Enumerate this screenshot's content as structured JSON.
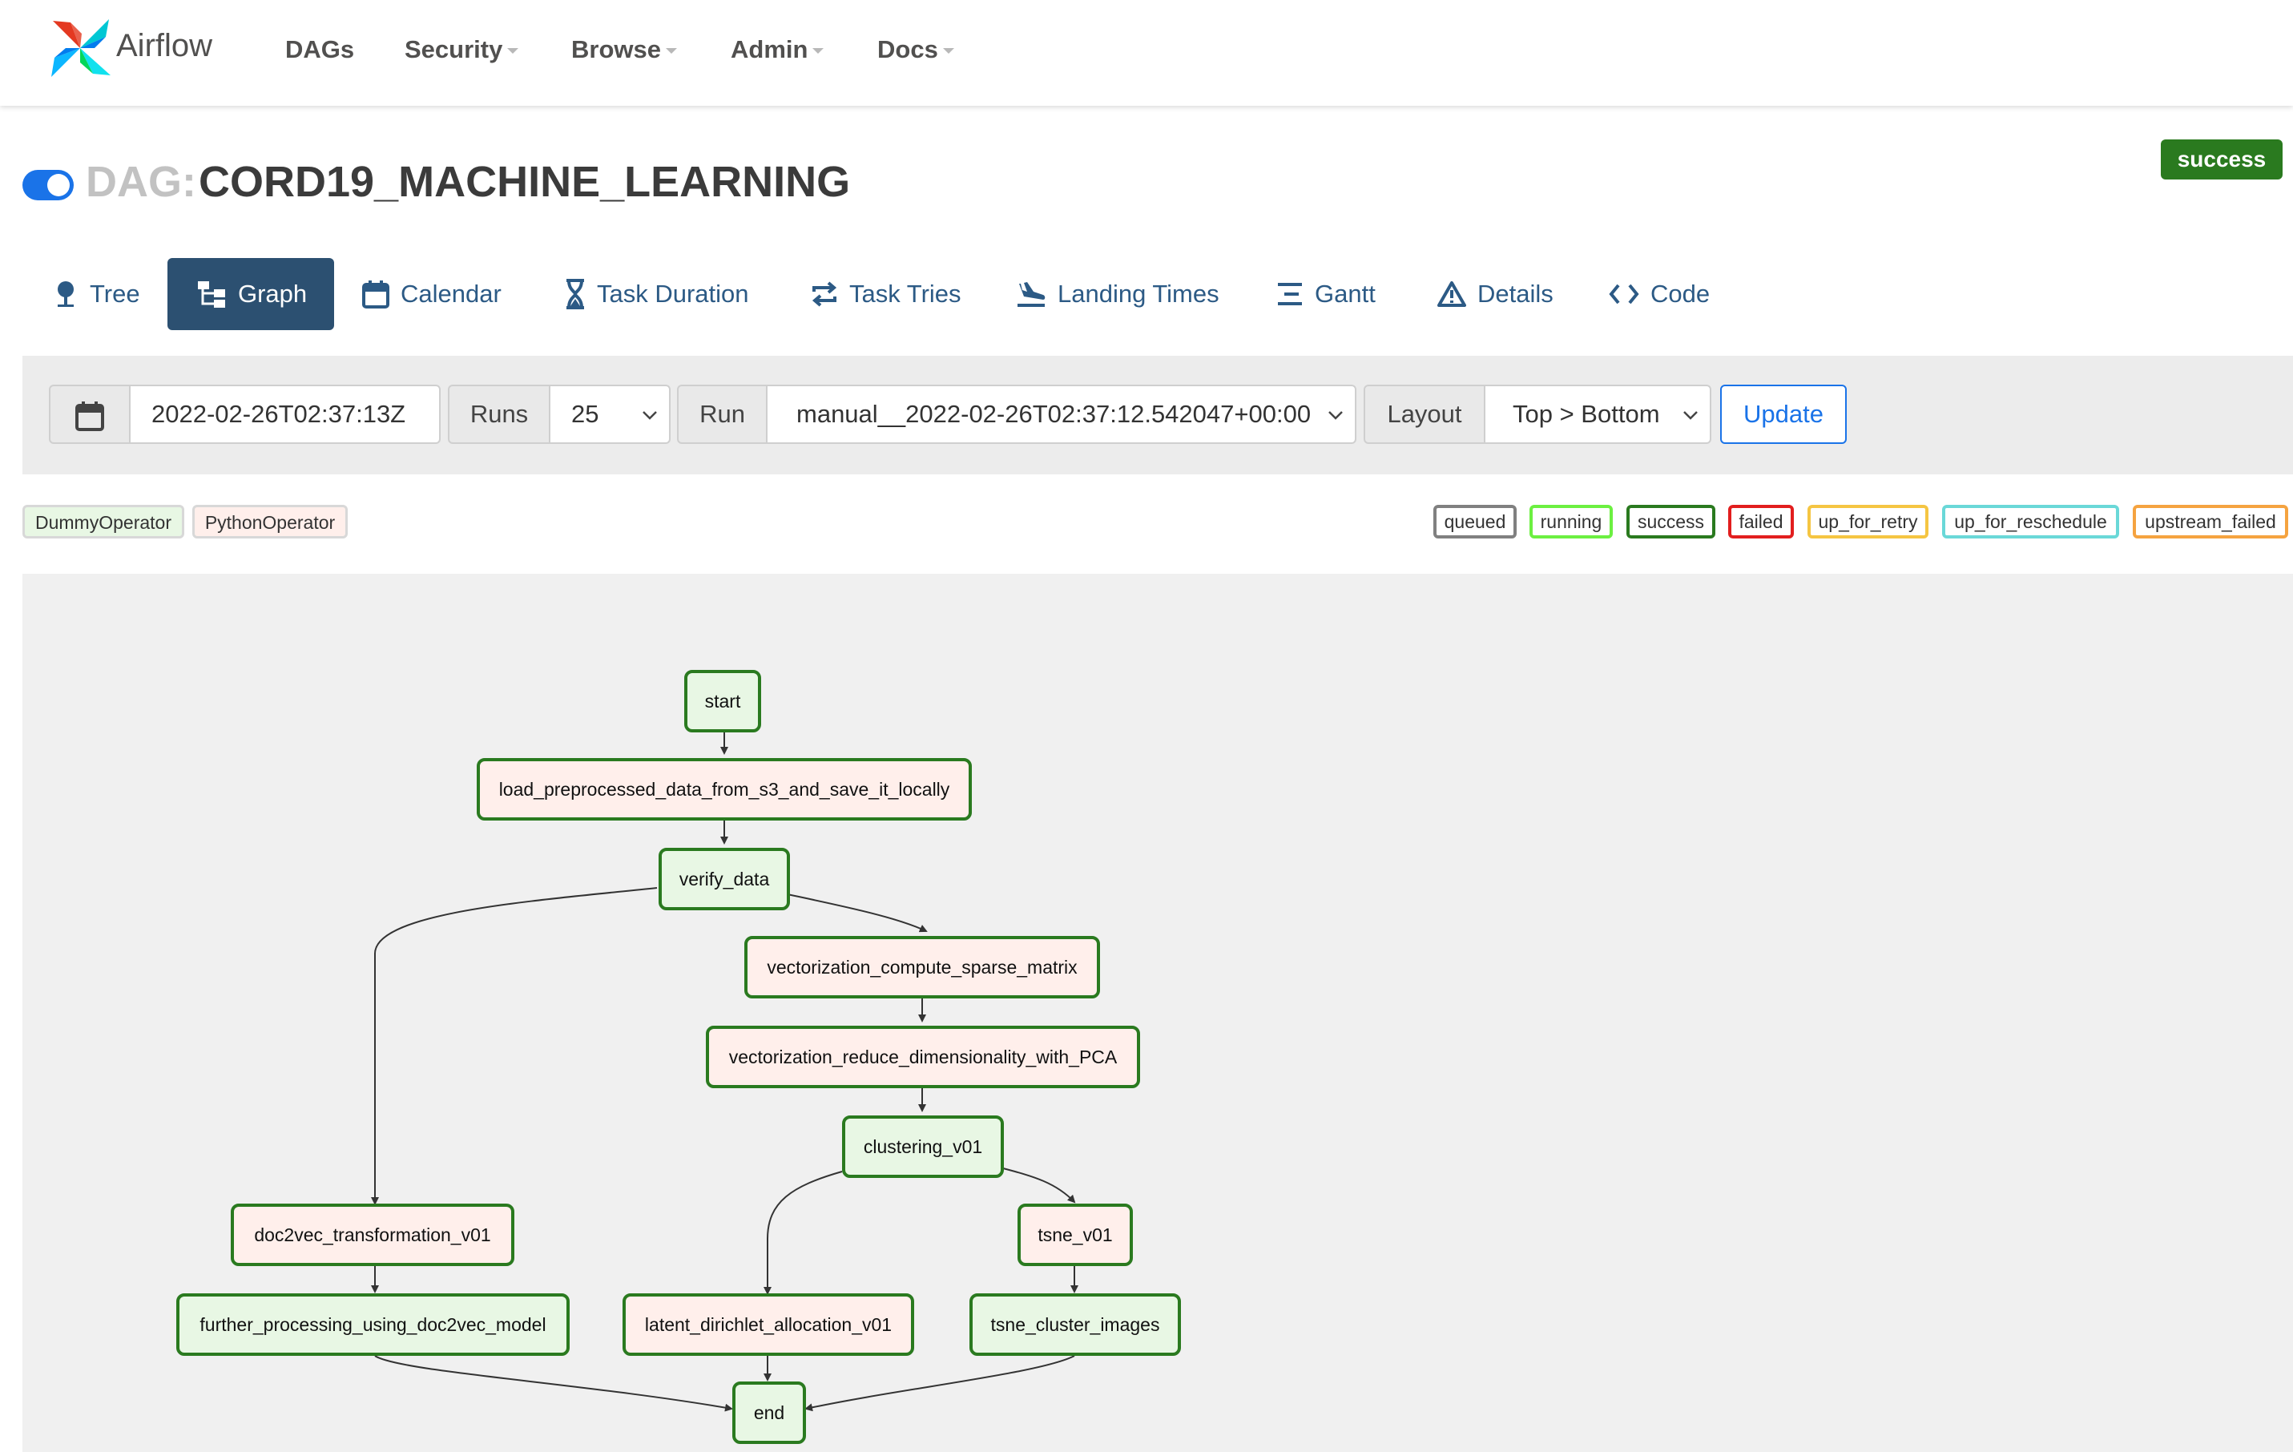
{
  "nav": {
    "brand": "Airflow",
    "items": [
      "DAGs",
      "Security",
      "Browse",
      "Admin",
      "Docs"
    ]
  },
  "dag": {
    "prefix": "DAG:",
    "name": "CORD19_MACHINE_LEARNING",
    "state": "success",
    "paused": false
  },
  "tabs": [
    {
      "label": "Tree",
      "icon": "tree-icon"
    },
    {
      "label": "Graph",
      "icon": "graph-icon",
      "active": true
    },
    {
      "label": "Calendar",
      "icon": "calendar-icon"
    },
    {
      "label": "Task Duration",
      "icon": "hourglass-icon"
    },
    {
      "label": "Task Tries",
      "icon": "repeat-icon"
    },
    {
      "label": "Landing Times",
      "icon": "plane-landing-icon"
    },
    {
      "label": "Gantt",
      "icon": "gantt-icon"
    },
    {
      "label": "Details",
      "icon": "warning-triangle-icon"
    },
    {
      "label": "Code",
      "icon": "code-icon"
    }
  ],
  "form": {
    "base_date": "2022-02-26T02:37:13Z",
    "runs_label": "Runs",
    "runs_value": "25",
    "run_label": "Run",
    "run_value": "manual__2022-02-26T02:37:12.542047+00:00",
    "layout_label": "Layout",
    "layout_value": "Top > Bottom",
    "update_label": "Update"
  },
  "operator_legend": [
    {
      "label": "DummyOperator",
      "color": "#e8f7e4"
    },
    {
      "label": "PythonOperator",
      "color": "#ffefeb"
    }
  ],
  "state_legend": [
    {
      "label": "queued",
      "color": "#808080"
    },
    {
      "label": "running",
      "color": "#6cf041"
    },
    {
      "label": "success",
      "color": "#2a7a1f"
    },
    {
      "label": "failed",
      "color": "#e21e1e"
    },
    {
      "label": "up_for_retry",
      "color": "#f5c542"
    },
    {
      "label": "up_for_reschedule",
      "color": "#6ad8d8"
    },
    {
      "label": "upstream_failed",
      "color": "#f5a340"
    }
  ],
  "graph": {
    "nodes": {
      "start": "start",
      "load": "load_preprocessed_data_from_s3_and_save_it_locally",
      "verify": "verify_data",
      "vec_sparse": "vectorization_compute_sparse_matrix",
      "vec_pca": "vectorization_reduce_dimensionality_with_PCA",
      "clustering": "clustering_v01",
      "doc2vec": "doc2vec_transformation_v01",
      "tsne": "tsne_v01",
      "further": "further_processing_using_doc2vec_model",
      "lda": "latent_dirichlet_allocation_v01",
      "tsne_img": "tsne_cluster_images",
      "end": "end"
    },
    "node_status": "success"
  },
  "colors": {
    "accent": "#1a73e8",
    "active_tab": "#2c5071",
    "success": "#2a7a1f",
    "dummy_operator": "#e8f7e4",
    "python_operator": "#ffefeb"
  }
}
